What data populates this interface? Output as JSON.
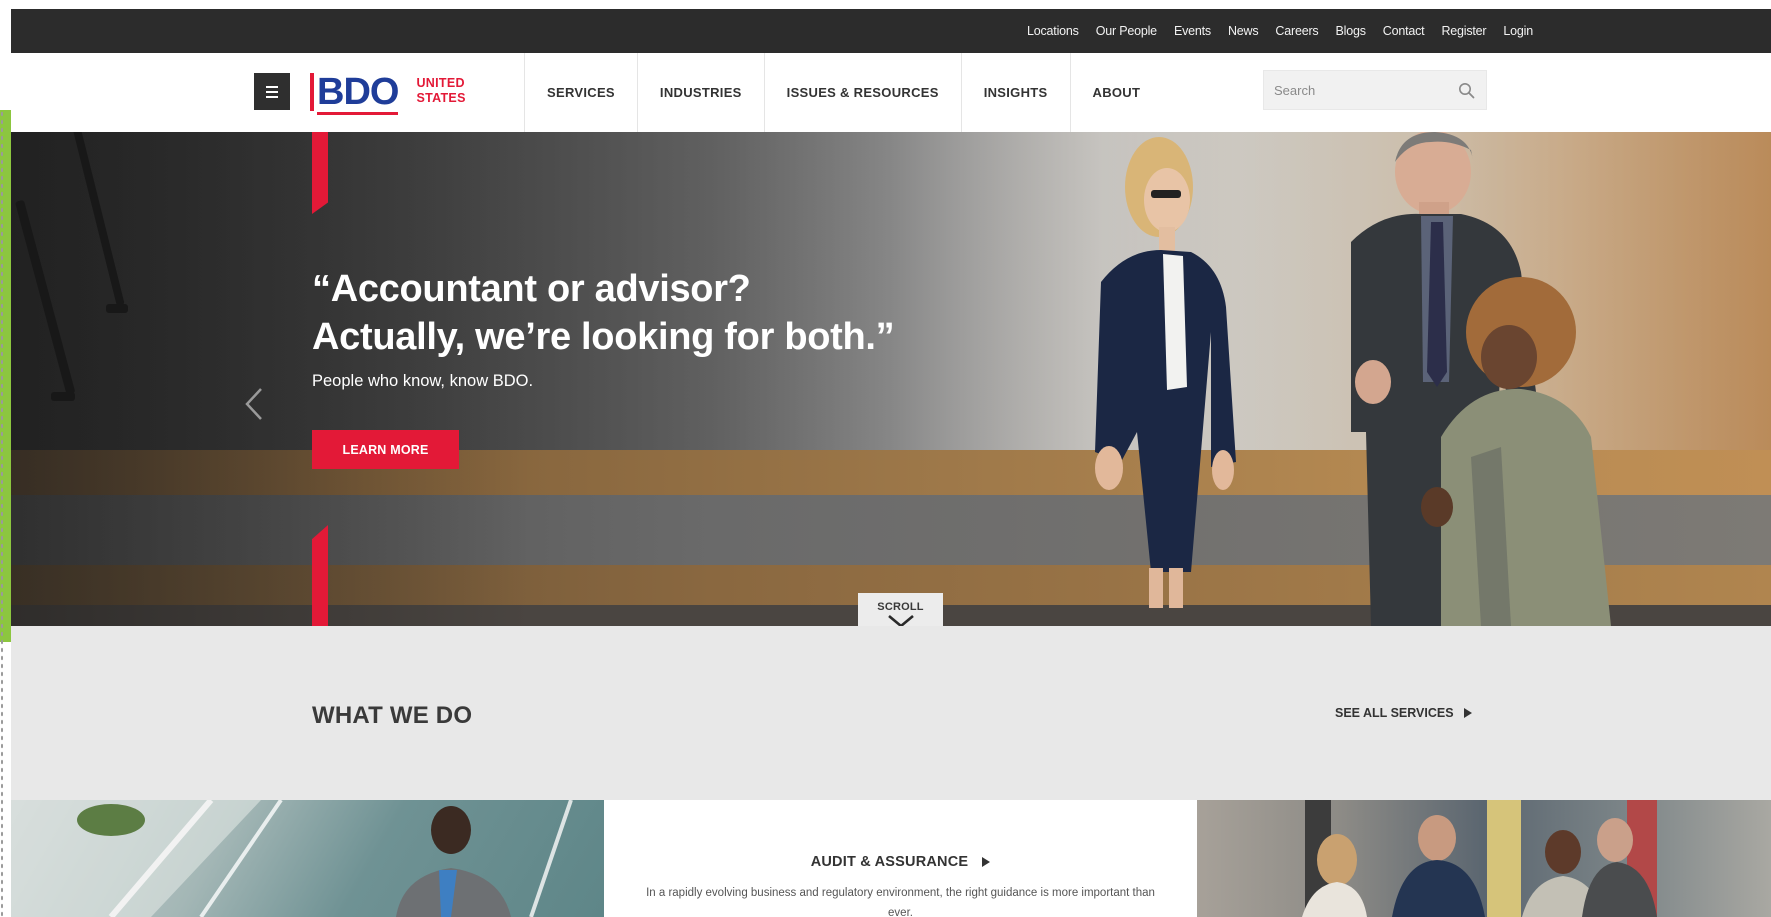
{
  "utility_nav": {
    "links": [
      "Locations",
      "Our People",
      "Events",
      "News",
      "Careers",
      "Blogs",
      "Contact",
      "Register",
      "Login"
    ]
  },
  "header": {
    "logo_text": "BDO",
    "logo_country_line1": "UNITED",
    "logo_country_line2": "STATES",
    "nav": [
      "SERVICES",
      "INDUSTRIES",
      "ISSUES & RESOURCES",
      "INSIGHTS",
      "ABOUT"
    ],
    "search_placeholder": "Search"
  },
  "hero": {
    "title_line1": "“Accountant or advisor?",
    "title_line2": "Actually, we’re looking for both.”",
    "subtitle": "People who know, know BDO.",
    "cta_label": "LEARN MORE",
    "scroll_label": "SCROLL"
  },
  "what_we_do": {
    "title": "WHAT WE DO",
    "see_all_label": "SEE ALL SERVICES"
  },
  "cards": {
    "middle_title": "AUDIT & ASSURANCE",
    "middle_desc": "In a rapidly evolving business and regulatory environment, the right guidance is more important than ever."
  },
  "colors": {
    "brand_red": "#e31937",
    "brand_blue": "#1f3d99",
    "utility_bar": "#2c2c2c",
    "section_gray": "#e8e8e8",
    "edge_green": "#8cc63f"
  },
  "icons": {
    "menu": "hamburger-icon",
    "search": "search-icon",
    "prev": "chevron-left-icon",
    "scroll": "chevron-down-icon",
    "see_all": "triangle-right-icon",
    "card_title": "triangle-right-icon"
  }
}
